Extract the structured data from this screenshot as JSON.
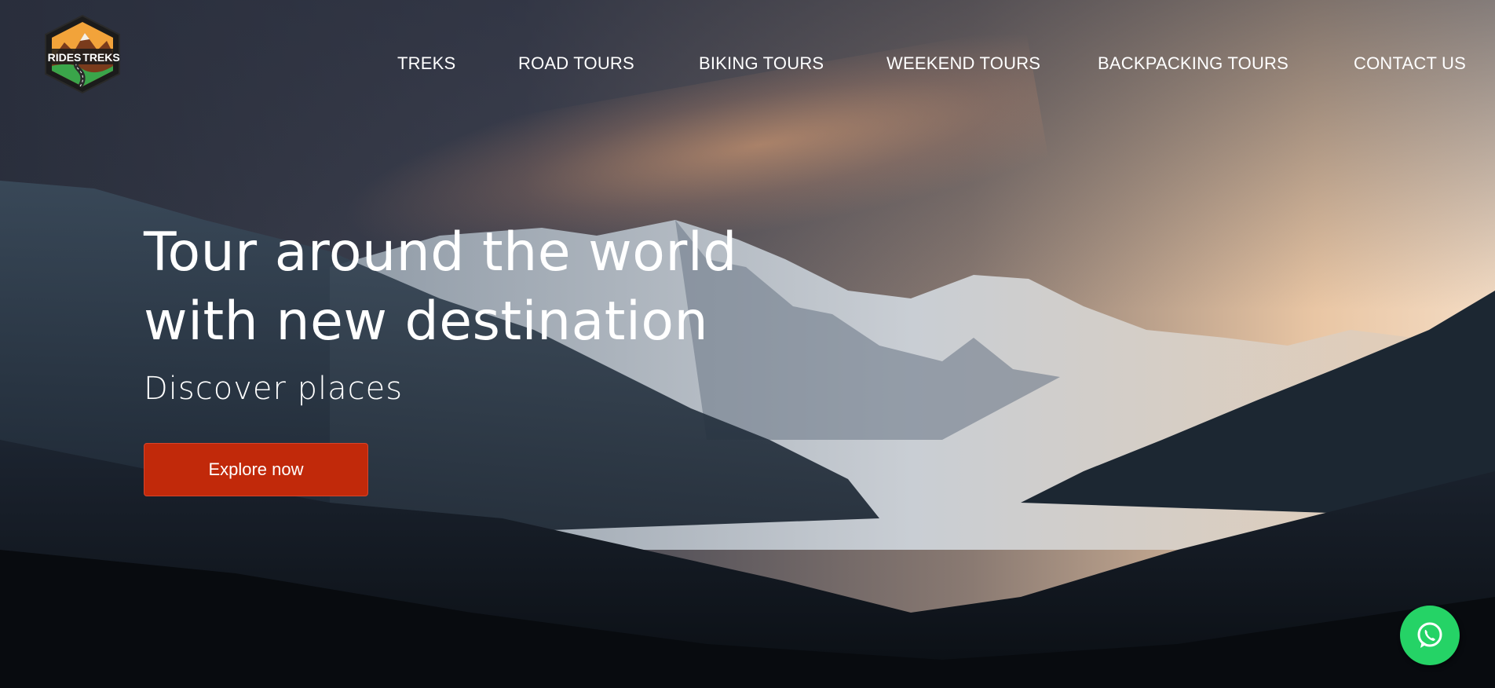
{
  "brand": {
    "logo_text_left": "RIDES",
    "logo_text_right": "TREKS",
    "logo_icon": "mountain-road-badge-icon"
  },
  "nav": {
    "items": [
      {
        "label": "TREKS"
      },
      {
        "label": "ROAD TOURS"
      },
      {
        "label": "BIKING TOURS"
      },
      {
        "label": "WEEKEND TOURS"
      },
      {
        "label": "BACKPACKING TOURS"
      },
      {
        "label": "CONTACT US"
      }
    ]
  },
  "hero": {
    "headline_line1": "Tour around the world",
    "headline_line2": "with new destination",
    "subheading": "Discover places",
    "cta_label": "Explore now"
  },
  "floating": {
    "whatsapp_icon": "whatsapp-icon"
  },
  "colors": {
    "cta": "#c1290a",
    "whatsapp": "#25d366",
    "nav_text": "#ffffff"
  }
}
